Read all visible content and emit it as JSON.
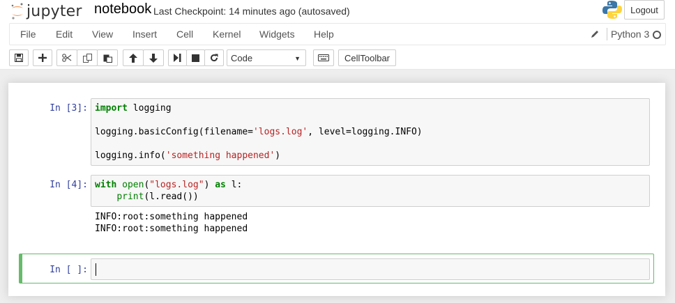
{
  "header": {
    "logo_text": "jupyter",
    "notebook_name": "notebook",
    "checkpoint": "Last Checkpoint: 14 minutes ago (autosaved)",
    "logout_label": "Logout",
    "python_logo_icon": "python-logo-icon"
  },
  "menu": {
    "items": [
      "File",
      "Edit",
      "View",
      "Insert",
      "Cell",
      "Kernel",
      "Widgets",
      "Help"
    ],
    "kernel_name": "Python 3",
    "edit_icon": "pencil-icon",
    "kernel_status_icon": "kernel-idle-circle-icon"
  },
  "toolbar": {
    "icons": [
      "save-icon",
      "plus-icon",
      "cut-icon",
      "copy-icon",
      "paste-icon",
      "arrow-up-icon",
      "arrow-down-icon",
      "step-forward-icon",
      "stop-icon",
      "refresh-icon",
      "keyboard-icon"
    ],
    "cell_type": "Code",
    "celltoolbar_label": "CellToolbar"
  },
  "cells": [
    {
      "prompt": "In [3]:",
      "lines": [
        "import logging",
        "",
        "logging.basicConfig(filename='logs.log', level=logging.INFO)",
        "",
        "logging.info('something happened')"
      ],
      "output": []
    },
    {
      "prompt": "In [4]:",
      "lines": [
        "with open(\"logs.log\") as l:",
        "    print(l.read())"
      ],
      "output": [
        "INFO:root:something happened",
        "INFO:root:something happened"
      ]
    },
    {
      "prompt": "In [ ]:",
      "lines": [
        ""
      ],
      "output": []
    }
  ],
  "colors": {
    "prompt_blue": "#303f9f",
    "keyword_green": "#008000",
    "string_red": "#ba2121",
    "selected_border": "#66bb6a"
  }
}
